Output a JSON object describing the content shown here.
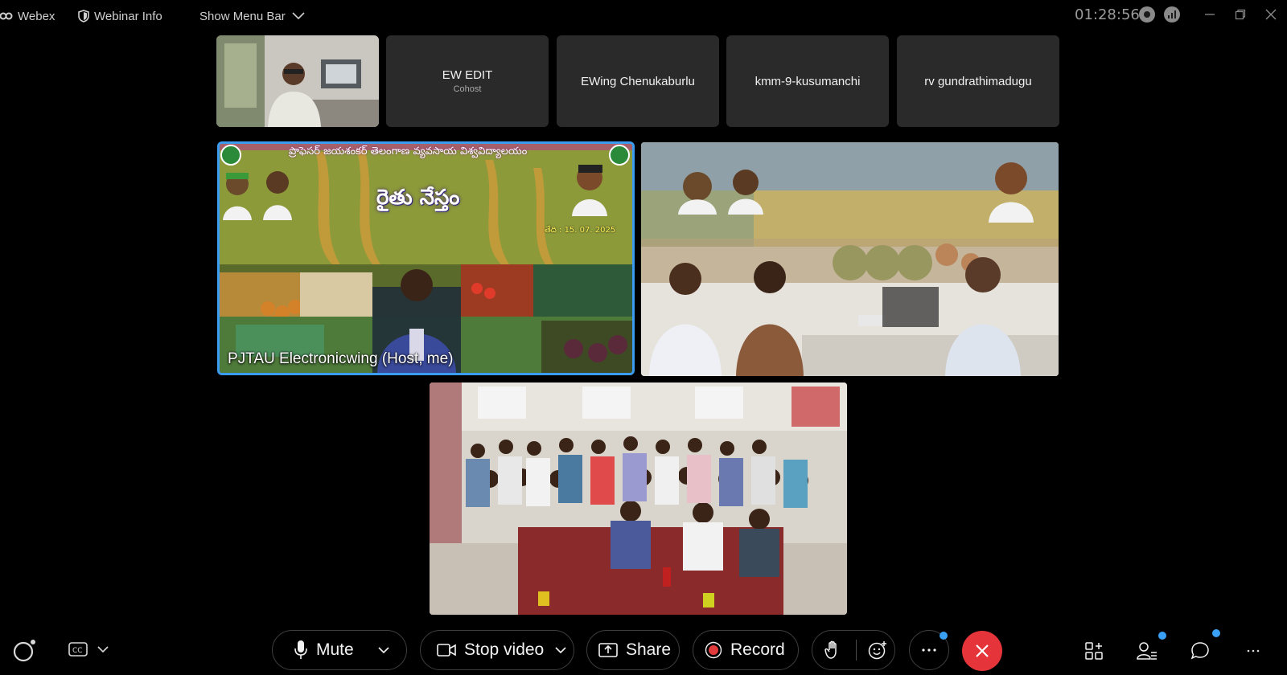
{
  "topbar": {
    "app_name": "Webex",
    "webinar_info_label": "Webinar Info",
    "menu_bar_label": "Show Menu Bar",
    "elapsed_time": "01:28:56"
  },
  "participants_strip": [
    {
      "name": "",
      "role": ""
    },
    {
      "name": "EW EDIT",
      "role": "Cohost"
    },
    {
      "name": "EWing Chenukaburlu",
      "role": ""
    },
    {
      "name": "kmm-9-kusumanchi",
      "role": ""
    },
    {
      "name": "rv gundrathimadugu",
      "role": ""
    }
  ],
  "videos": {
    "main_label": "PJTAU Electronicwing (Host, me)",
    "banner_title": "రైతు నేస్తం",
    "banner_top": "ప్రొఫెసర్ జయశంకర్ తెలంగాణ వ్యవసాయ విశ్వవిద్యాలయం",
    "banner_date": "తేది : 15. 07. 2025"
  },
  "toolbar": {
    "mute_label": "Mute",
    "stop_video_label": "Stop video",
    "share_label": "Share",
    "record_label": "Record"
  },
  "colors": {
    "accent": "#3a9bf0",
    "end_call": "#e6353a",
    "record_dot": "#e23b3b",
    "tile_bg": "#2a2a2a"
  }
}
